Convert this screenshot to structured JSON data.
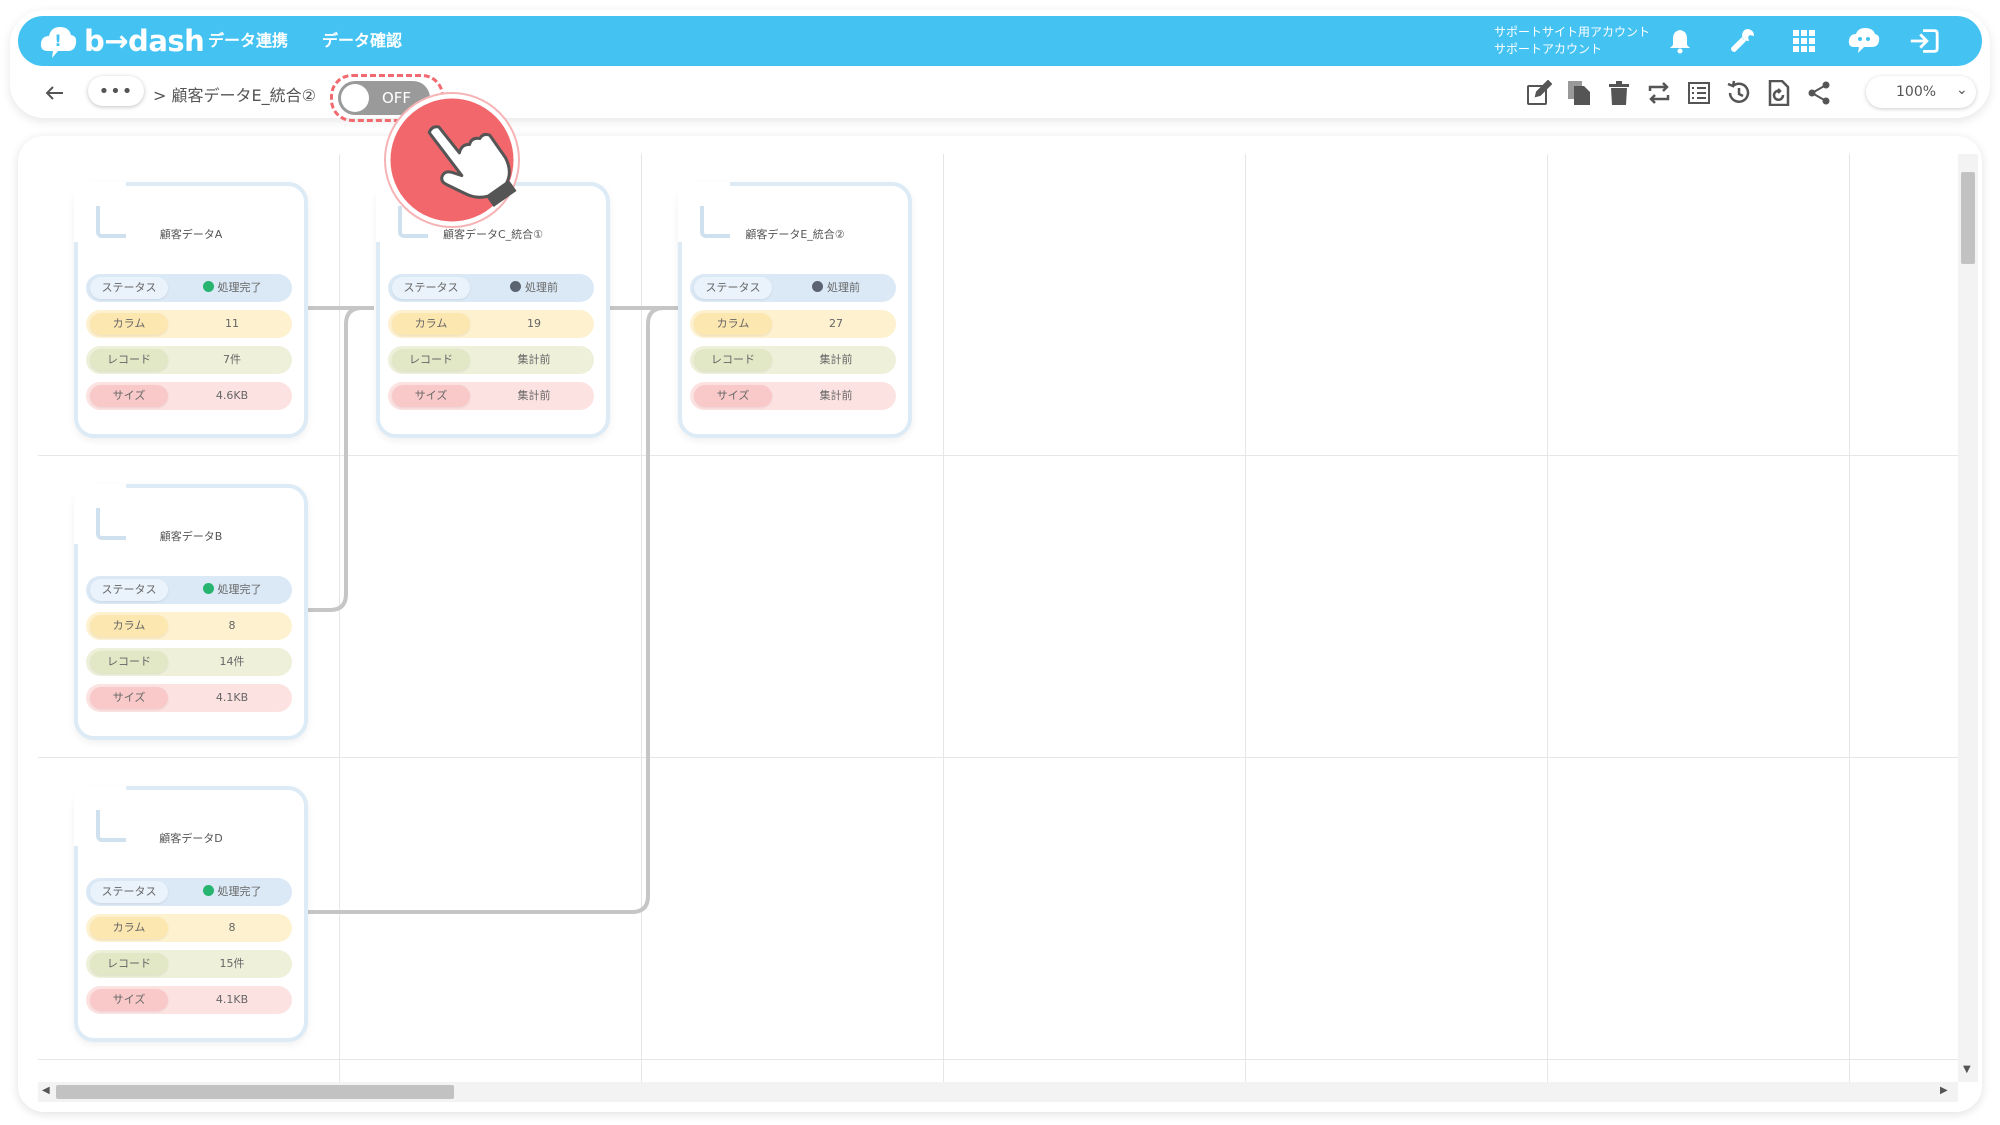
{
  "brand": {
    "logo_text": "b→dash",
    "accent": "#44c3f3"
  },
  "nav": {
    "links": [
      "データ連携",
      "データ確認"
    ],
    "account_line1": "サポートサイト用アカウント",
    "account_line2": "サポートアカウント"
  },
  "toolbar": {
    "more_label": "•••",
    "breadcrumb": "> 顧客データE_統合②",
    "toggle_label": "OFF",
    "zoom": "100%",
    "zoom_chevron": "⌄"
  },
  "cards": [
    {
      "title": "顧客データA",
      "status": "処理完了",
      "state": "done",
      "column": "11",
      "record": "7件",
      "size": "4.6KB"
    },
    {
      "title": "顧客データC_統合①",
      "status": "処理前",
      "state": "pending",
      "column": "19",
      "record": "集計前",
      "size": "集計前"
    },
    {
      "title": "顧客データE_統合②",
      "status": "処理前",
      "state": "pending",
      "column": "27",
      "record": "集計前",
      "size": "集計前"
    },
    {
      "title": "顧客データB",
      "status": "処理完了",
      "state": "done",
      "column": "8",
      "record": "14件",
      "size": "4.1KB"
    },
    {
      "title": "顧客データD",
      "status": "処理完了",
      "state": "done",
      "column": "8",
      "record": "15件",
      "size": "4.1KB"
    }
  ],
  "row_labels": {
    "status": "ステータス",
    "column": "カラム",
    "record": "レコード",
    "size": "サイズ"
  },
  "icons": {
    "notification": "bell-icon",
    "settings": "wrench-icon",
    "apps": "grid-icon",
    "support": "chat-icon",
    "logout": "logout-icon"
  }
}
